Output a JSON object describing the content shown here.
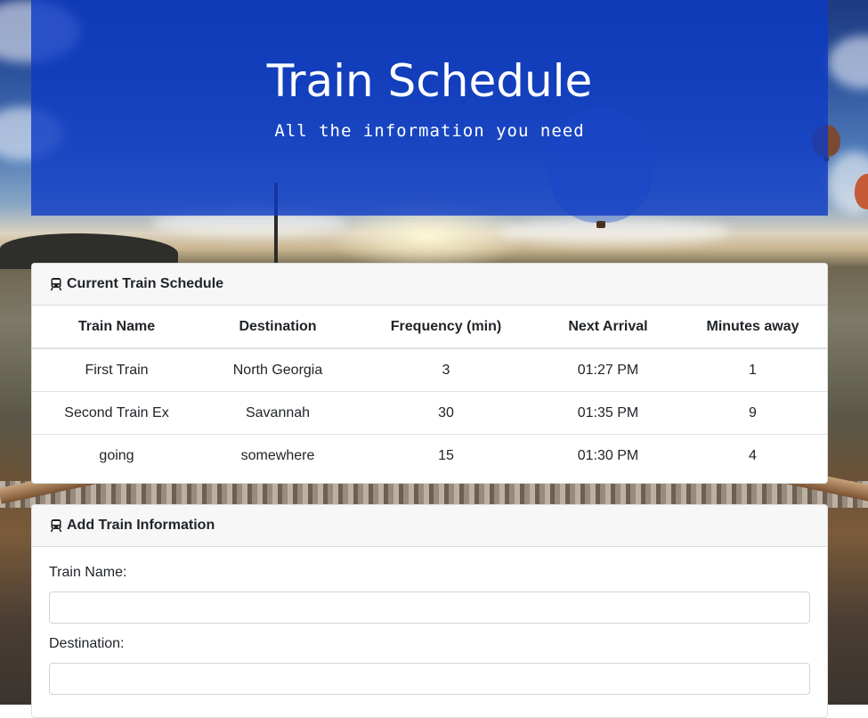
{
  "header": {
    "title": "Train Schedule",
    "subtitle": "All the information you need"
  },
  "schedule": {
    "heading": "Current Train Schedule",
    "icon": "train-icon",
    "columns": [
      "Train Name",
      "Destination",
      "Frequency (min)",
      "Next Arrival",
      "Minutes away"
    ],
    "rows": [
      [
        "First Train",
        "North Georgia",
        "3",
        "01:27 PM",
        "1"
      ],
      [
        "Second Train Ex",
        "Savannah",
        "30",
        "01:35 PM",
        "9"
      ],
      [
        "going",
        "somewhere",
        "15",
        "01:30 PM",
        "4"
      ]
    ]
  },
  "add_train": {
    "heading": "Add Train Information",
    "icon": "train-icon",
    "fields": {
      "train_name": {
        "label": "Train Name:",
        "value": "",
        "placeholder": ""
      },
      "destination": {
        "label": "Destination:",
        "value": "",
        "placeholder": ""
      }
    }
  },
  "colors": {
    "jumbotron": "#0c3ac4",
    "card_header": "#f7f7f7"
  }
}
